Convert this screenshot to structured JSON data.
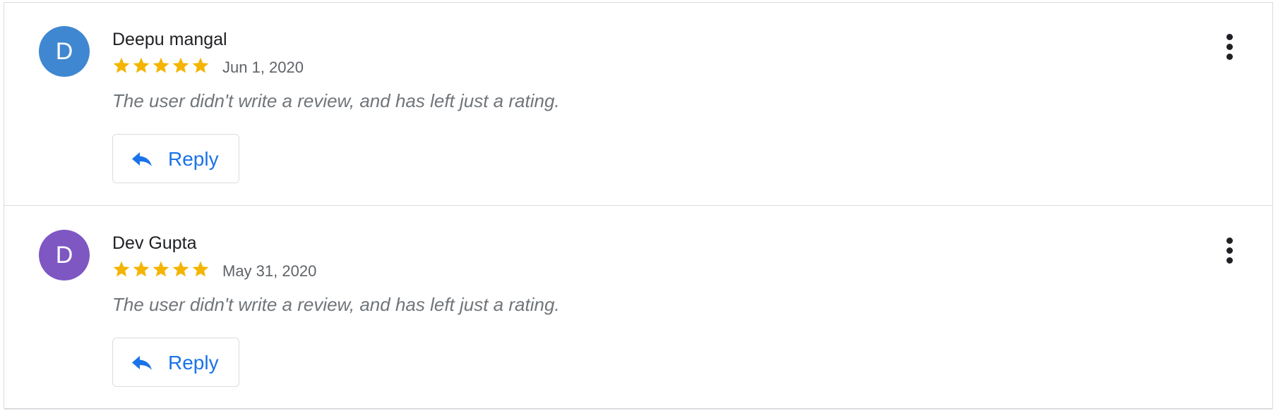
{
  "reviews": [
    {
      "avatar_letter": "D",
      "avatar_color": "#3f87d1",
      "author": "Deepu mangal",
      "rating": 5,
      "date": "Jun 1, 2020",
      "text": "The user didn't write a review, and has left just a rating.",
      "reply_label": "Reply"
    },
    {
      "avatar_letter": "D",
      "avatar_color": "#7e57c2",
      "author": "Dev Gupta",
      "rating": 5,
      "date": "May 31, 2020",
      "text": "The user didn't write a review, and has left just a rating.",
      "reply_label": "Reply"
    }
  ],
  "colors": {
    "star": "#f4b400",
    "accent": "#1a73e8",
    "divider": "#dadce0"
  },
  "icons": {
    "star": "star-icon",
    "reply": "reply-icon",
    "more": "more-vert-icon"
  }
}
